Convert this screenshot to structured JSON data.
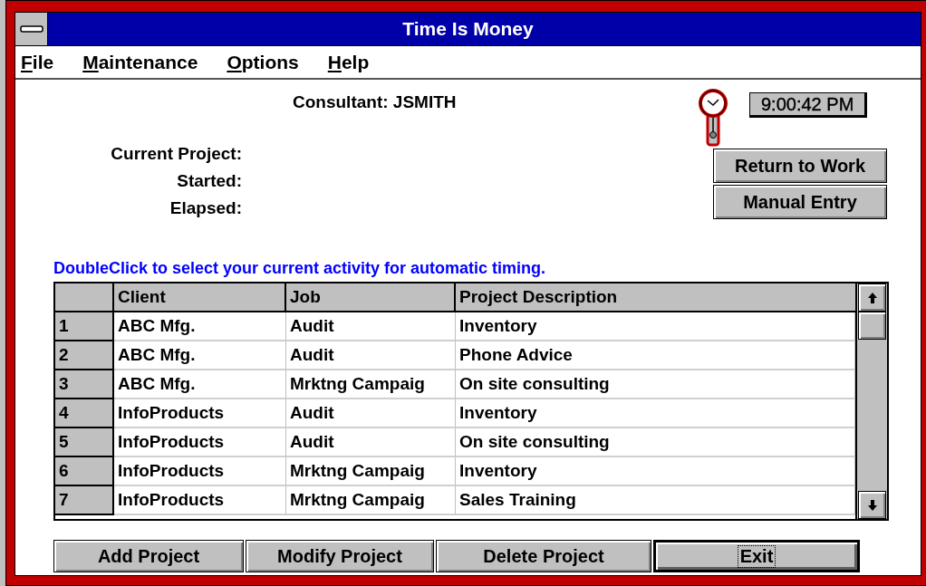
{
  "window": {
    "title": "Time Is Money"
  },
  "menu": [
    {
      "label": "File"
    },
    {
      "label": "Maintenance"
    },
    {
      "label": "Options"
    },
    {
      "label": "Help"
    }
  ],
  "consultant": "Consultant: JSMITH",
  "fields": [
    {
      "label": "Current Project:"
    },
    {
      "label": "Started:"
    },
    {
      "label": "Elapsed:"
    }
  ],
  "clock_time": "9:00:42 PM",
  "side_buttons": [
    {
      "label": "Return to Work"
    },
    {
      "label": "Manual Entry"
    }
  ],
  "instruction": "DoubleClick to select your current activity for automatic timing.",
  "table": {
    "columns": [
      "Client",
      "Job",
      "Project Description"
    ],
    "rows": [
      {
        "number": "1",
        "cells": [
          "ABC Mfg.",
          "Audit",
          "Inventory"
        ]
      },
      {
        "number": "2",
        "cells": [
          "ABC Mfg.",
          "Audit",
          "Phone Advice"
        ]
      },
      {
        "number": "3",
        "cells": [
          "ABC Mfg.",
          "Mrktng Campaig",
          "On site consulting"
        ]
      },
      {
        "number": "4",
        "cells": [
          "InfoProducts",
          "Audit",
          "Inventory"
        ]
      },
      {
        "number": "5",
        "cells": [
          "InfoProducts",
          "Audit",
          "On site consulting"
        ]
      },
      {
        "number": "6",
        "cells": [
          "InfoProducts",
          "Mrktng Campaig",
          "Inventory"
        ]
      },
      {
        "number": "7",
        "cells": [
          "InfoProducts",
          "Mrktng Campaig",
          "Sales Training"
        ]
      }
    ]
  },
  "buttons": [
    {
      "label": "Add Project",
      "focused": false
    },
    {
      "label": "Modify Project",
      "focused": false
    },
    {
      "label": "Delete Project",
      "focused": false
    },
    {
      "label": "Exit",
      "focused": true
    }
  ]
}
